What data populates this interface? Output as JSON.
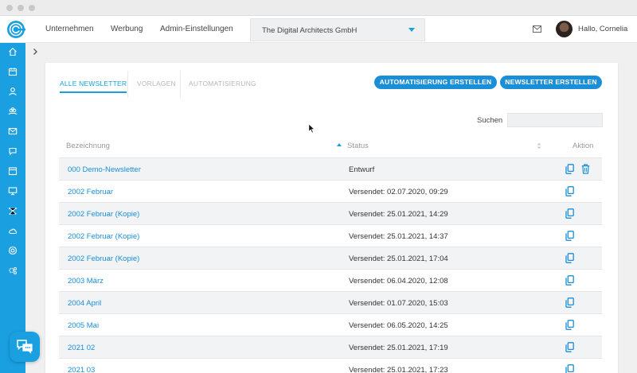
{
  "nav": {
    "links": [
      "Unternehmen",
      "Werbung",
      "Admin-Einstellungen"
    ],
    "company": "The Digital Architects GmbH",
    "user": "Hallo, Cornelia",
    "icons": [
      "mail-icon",
      "avatar"
    ]
  },
  "sidebar": {
    "icons": [
      "home-icon",
      "calendar-icon",
      "contacts-icon",
      "groups-icon",
      "mail-icon",
      "chat-icon",
      "window-icon",
      "monitor-icon",
      "network-icon",
      "cloud-icon",
      "support-icon",
      "settings-icon"
    ],
    "accent": "#1aa0e0"
  },
  "tabs": {
    "all": "ALLE NEWSLETTER",
    "templates": "VORLAGEN",
    "automation": "AUTOMATISIERUNG"
  },
  "buttons": {
    "create_automation": "AUTOMATISIERUNG ERSTELLEN",
    "create_newsletter": "NEWSLETTER ERSTELLEN"
  },
  "search": {
    "label": "Suchen",
    "value": ""
  },
  "table": {
    "headers": {
      "name": "Bezeichnung",
      "status": "Status",
      "action": "Aktion"
    },
    "rows": [
      {
        "name": "000 Demo-Newsletter",
        "status": "Entwurf",
        "actions": [
          "copy-icon",
          "trash-icon"
        ]
      },
      {
        "name": "2002 Februar",
        "status": "Versendet: 02.07.2020, 09:29",
        "actions": [
          "copy-icon"
        ]
      },
      {
        "name": "2002 Februar (Kopie)",
        "status": "Versendet: 25.01.2021, 14:29",
        "actions": [
          "copy-icon"
        ]
      },
      {
        "name": "2002 Februar (Kopie)",
        "status": "Versendet: 25.01.2021, 14:37",
        "actions": [
          "copy-icon"
        ]
      },
      {
        "name": "2002 Februar (Kopie)",
        "status": "Versendet: 25.01.2021, 17:04",
        "actions": [
          "copy-icon"
        ]
      },
      {
        "name": "2003 März",
        "status": "Versendet: 06.04.2020, 12:08",
        "actions": [
          "copy-icon"
        ]
      },
      {
        "name": "2004 April",
        "status": "Versendet: 01.07.2020, 15:03",
        "actions": [
          "copy-icon"
        ]
      },
      {
        "name": "2005 Mai",
        "status": "Versendet: 06.05.2020, 14:25",
        "actions": [
          "copy-icon"
        ]
      },
      {
        "name": "2021 02",
        "status": "Versendet: 25.01.2021, 17:19",
        "actions": [
          "copy-icon"
        ]
      },
      {
        "name": "2021 03",
        "status": "Versendet: 25.01.2021, 17:23",
        "actions": [
          "copy-icon"
        ]
      }
    ]
  }
}
